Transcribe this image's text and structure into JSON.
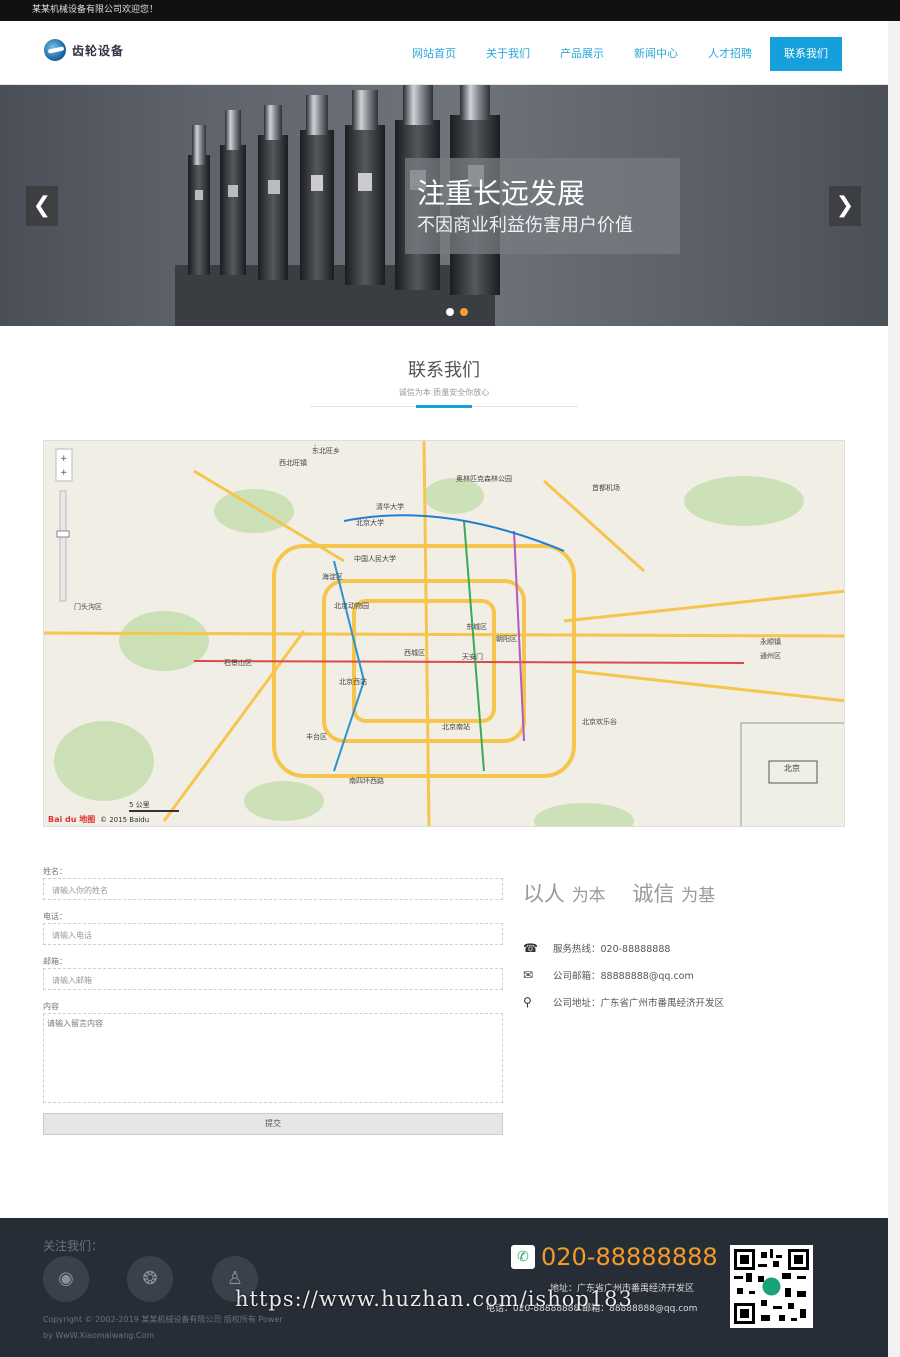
{
  "topbar": {
    "welcome": "某某机械设备有限公司欢迎您！"
  },
  "logo": {
    "text": "齿轮设备"
  },
  "nav": {
    "items": [
      {
        "label": "网站首页"
      },
      {
        "label": "关于我们"
      },
      {
        "label": "产品展示"
      },
      {
        "label": "新闻中心"
      },
      {
        "label": "人才招聘"
      },
      {
        "label": "联系我们"
      }
    ],
    "active_index": 5
  },
  "banner": {
    "title": "注重长远发展",
    "subtitle": "不因商业利益伤害用户价值",
    "prev_arrow": "❮",
    "next_arrow": "❯",
    "slide_count": 2,
    "active_slide": 1
  },
  "section": {
    "title": "联系我们",
    "subtitle": "诚信为本·质量安全你放心"
  },
  "map": {
    "labels": [
      "东北旺乡",
      "西北旺镇",
      "奥林匹克森林公园",
      "清华大学",
      "北京大学",
      "中国人民大学",
      "海淀区",
      "北京动物园",
      "北京西站",
      "西城区",
      "东城区",
      "朝阳区",
      "天安门",
      "石景山区",
      "丰台区",
      "北京南站",
      "南四环西路",
      "北京欢乐谷",
      "通州区",
      "永顺镇",
      "门头沟区",
      "北京",
      "首都机场"
    ],
    "scale": "5 公里",
    "copyright": "© 2015 Baidu",
    "brand": "Bai du 地图",
    "mini_label": "北京"
  },
  "form": {
    "name_label": "姓名：",
    "name_placeholder": "请输入你的姓名",
    "phone_label": "电话：",
    "phone_placeholder": "请输入电话",
    "email_label": "邮箱：",
    "email_placeholder": "请输入邮箱",
    "content_label": "内容",
    "content_placeholder": "请输入留言内容",
    "submit_label": "提交"
  },
  "info": {
    "slogan_big1": "以人",
    "slogan_small1": "为本",
    "slogan_big2": "诚信",
    "slogan_small2": "为基",
    "rows": [
      {
        "icon": "☎",
        "text": "服务热线：020-88888888"
      },
      {
        "icon": "✉",
        "text": "公司邮箱：88888888@qq.com"
      },
      {
        "icon": "⚲",
        "text": "公司地址：广东省广州市番禺经济开发区"
      }
    ]
  },
  "footer": {
    "follow": "关注我们：",
    "social_icons": [
      "weibo-icon",
      "wechat-icon",
      "qq-icon"
    ],
    "copyright": "Copyright © 2002-2019 某某机械设备有限公司 版权所有 Power",
    "by": "by WwW.Xiaomaiwang.Com",
    "hotline": "020-88888888",
    "address": "地址：广东省广州市番禺经济开发区",
    "contact": "电话：020-88888888 邮箱：88888888@qq.com"
  },
  "watermark": "https://www.huzhan.com/ishop183",
  "colors": {
    "accent": "#15a0dc",
    "orange": "#f29a2a",
    "footer_bg": "#272d36"
  }
}
